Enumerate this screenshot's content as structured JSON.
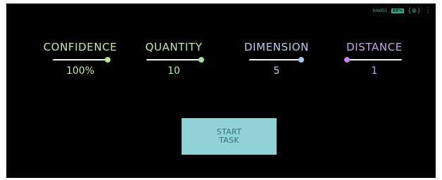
{
  "status_bar": {
    "left_text": "hmd01",
    "battery": "88%",
    "vr_icon": "vr-headset-icon",
    "menu_icon": "menu-icon"
  },
  "params": [
    {
      "label": "CONFIDENCE",
      "value": "100%",
      "slider_fraction": 1.0,
      "color": "#cfe7a4"
    },
    {
      "label": "QUANTITY",
      "value": "10",
      "slider_fraction": 1.0,
      "color": "#bfeab0"
    },
    {
      "label": "DIMENSION",
      "value": "5",
      "slider_fraction": 0.95,
      "color": "#b9cff0"
    },
    {
      "label": "DISTANCE",
      "value": "1",
      "slider_fraction": 0.0,
      "color": "#c7a5ea"
    }
  ],
  "start_button": {
    "line1": "START",
    "line2": "TASK",
    "color": "#8fd3d7"
  }
}
